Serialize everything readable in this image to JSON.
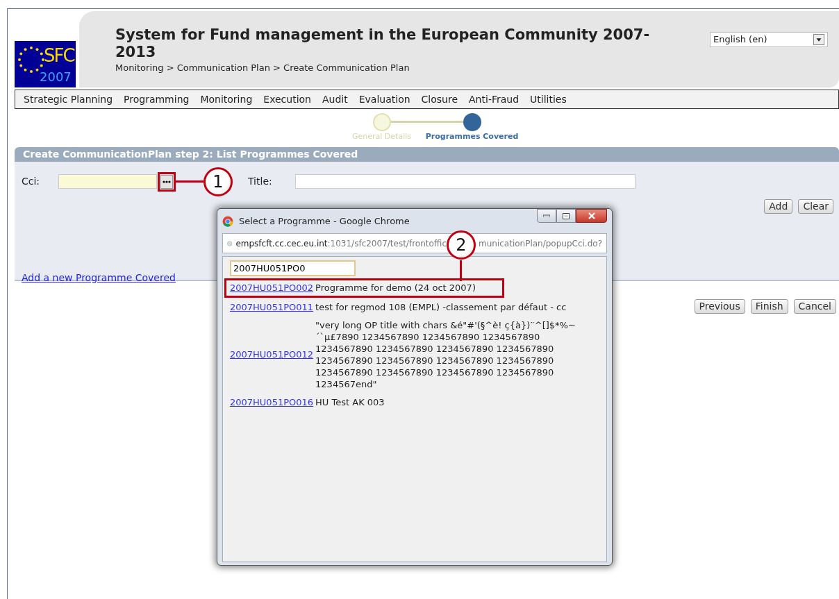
{
  "logo": {
    "text": "SFC",
    "year": "2007"
  },
  "header": {
    "title": "System for Fund management in the European Community 2007-2013",
    "breadcrumb": "Monitoring > Communication Plan > Create Communication Plan",
    "language": "English (en)"
  },
  "menu": [
    "Strategic Planning",
    "Programming",
    "Monitoring",
    "Execution",
    "Audit",
    "Evaluation",
    "Closure",
    "Anti-Fraud",
    "Utilities"
  ],
  "steps": [
    {
      "label": "General Details",
      "selected": false
    },
    {
      "label": "Programmes Covered",
      "selected": true
    }
  ],
  "section_title": "Create CommunicationPlan step 2: List Programmes Covered",
  "form": {
    "cci_label": "Cci:",
    "title_label": "Title:",
    "buttons": [
      "Add",
      "Clear"
    ],
    "add_link": "Add a new Programme Covered"
  },
  "callouts": [
    {
      "number": "1"
    },
    {
      "number": "2"
    }
  ],
  "nav_buttons": [
    "Previous",
    "Finish",
    "Cancel"
  ],
  "popup": {
    "title": "Select a Programme - Google Chrome",
    "url": [
      "empsfcft.cc.cec.eu.int",
      ":1031/sfc2007/test/frontoffic",
      "municationPlan/popupCci.do?"
    ],
    "search_value": "2007HU051PO0",
    "results": [
      {
        "code": "2007HU051PO002",
        "title": "Programme for demo (24 oct 2007)",
        "highlighted": true
      },
      {
        "code": "2007HU051PO011",
        "title": "test for regmod 108 (EMPL) -classement par défaut - cc",
        "highlighted": false
      },
      {
        "code": "2007HU051PO012",
        "title": "\"very long OP title with chars &é\"#'(§^è! ç{à})¨^[]$*%~´`µ£7890 1234567890 1234567890 1234567890 1234567890 1234567890 1234567890 1234567890 1234567890 1234567890 1234567890 1234567890 1234567890 1234567890 1234567890 1234567890 1234567end\"",
        "highlighted": false
      },
      {
        "code": "2007HU051PO016",
        "title": "HU Test AK 003",
        "highlighted": false
      }
    ]
  }
}
